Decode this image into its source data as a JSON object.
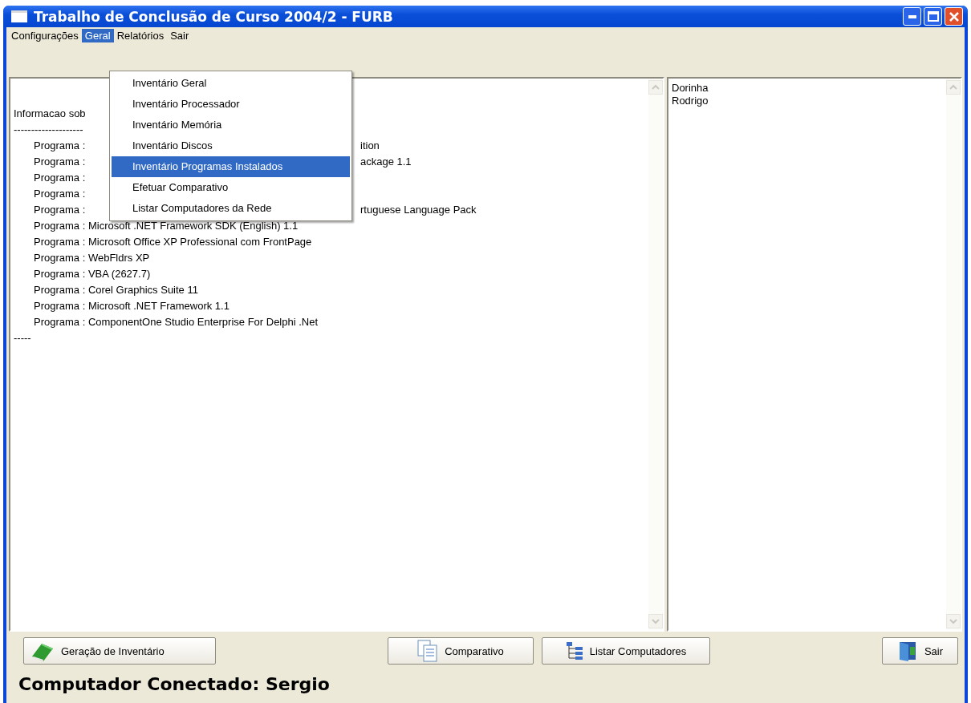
{
  "window": {
    "title": "Trabalho de Conclusão de Curso 2004/2 - FURB"
  },
  "menu_bar": [
    {
      "label": "Configurações",
      "selected": false
    },
    {
      "label": "Geral",
      "selected": true
    },
    {
      "label": "Relatórios",
      "selected": false
    },
    {
      "label": "Sair",
      "selected": false
    }
  ],
  "dropdown_menu": [
    {
      "label": "Inventário Geral",
      "selected": false
    },
    {
      "label": "Inventário Processador",
      "selected": false
    },
    {
      "label": "Inventário Memória",
      "selected": false
    },
    {
      "label": "Inventário Discos",
      "selected": false
    },
    {
      "label": "Inventário Programas Instalados",
      "selected": true
    },
    {
      "label": "Efetuar Comparativo",
      "selected": false
    },
    {
      "label": "Listar Computadores da Rede",
      "selected": false
    }
  ],
  "output_lines": [
    {
      "text": "Informacao sob",
      "kind": "plain"
    },
    {
      "text": "--------------------",
      "kind": "plain"
    },
    {
      "text": "Programa :",
      "continuation": "ition",
      "kind": "program"
    },
    {
      "text": "Programa :",
      "continuation": "ackage 1.1",
      "kind": "program"
    },
    {
      "text": "Programa :",
      "kind": "program"
    },
    {
      "text": "Programa :",
      "kind": "program"
    },
    {
      "text": "Programa :",
      "continuation": "rtuguese Language Pack",
      "kind": "program"
    },
    {
      "text": "Programa : Microsoft .NET Framework SDK (English) 1.1",
      "kind": "program"
    },
    {
      "text": "Programa : Microsoft Office XP Professional com FrontPage",
      "kind": "program"
    },
    {
      "text": "Programa : WebFldrs XP",
      "kind": "program"
    },
    {
      "text": "Programa : VBA (2627.7)",
      "kind": "program"
    },
    {
      "text": "Programa : Corel Graphics Suite 11",
      "kind": "program"
    },
    {
      "text": "Programa : Microsoft .NET Framework 1.1",
      "kind": "program"
    },
    {
      "text": "Programa : ComponentOne Studio Enterprise For Delphi .Net",
      "kind": "program"
    },
    {
      "text": "-----",
      "kind": "plain"
    }
  ],
  "computers": [
    "Dorinha",
    "Rodrigo"
  ],
  "buttons": [
    {
      "label": "Geração de Inventário",
      "kind": "book"
    },
    {
      "label": "Comparativo",
      "kind": "document"
    },
    {
      "label": "Listar Computadores",
      "kind": "tree"
    },
    {
      "label": "Sair",
      "kind": "door"
    }
  ],
  "status": "Computador Conectado: Sergio"
}
